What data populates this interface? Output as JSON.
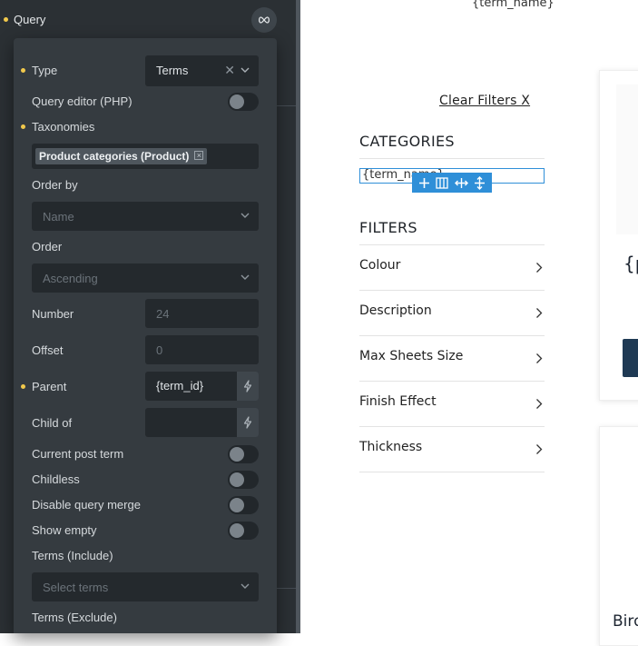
{
  "query": {
    "title": "Query"
  },
  "popup": {
    "type_label": "Type",
    "type_value": "Terms",
    "query_editor_label": "Query editor (PHP)",
    "taxonomies_label": "Taxonomies",
    "taxonomy_tag": "Product categories (Product)",
    "order_by_label": "Order by",
    "order_by_value": "Name",
    "order_label": "Order",
    "order_value": "Ascending",
    "number_label": "Number",
    "number_placeholder": "24",
    "offset_label": "Offset",
    "offset_placeholder": "0",
    "parent_label": "Parent",
    "parent_value": "{term_id}",
    "child_of_label": "Child of",
    "current_post_term_label": "Current post term",
    "childless_label": "Childless",
    "disable_query_merge_label": "Disable query merge",
    "show_empty_label": "Show empty",
    "terms_include_label": "Terms (Include)",
    "terms_include_placeholder": "Select terms",
    "terms_exclude_label": "Terms (Exclude)"
  },
  "canvas": {
    "term_name_top": "{term_name}",
    "clear_filters": "Clear Filters X",
    "categories_title": "CATEGORIES",
    "term_name_selected": "{term_name}",
    "filters_title": "FILTERS",
    "filters": [
      "Colour",
      "Description",
      "Max Sheets Size",
      "Finish Effect",
      "Thickness"
    ],
    "card_text": "{p",
    "bird_text": "Bird"
  },
  "colors": {
    "panel_bg": "#2b3034",
    "popup_bg": "#353b40",
    "field_bg": "#24292d",
    "accent_dot": "#f2c94c",
    "selection_blue": "#2f8fd8"
  }
}
